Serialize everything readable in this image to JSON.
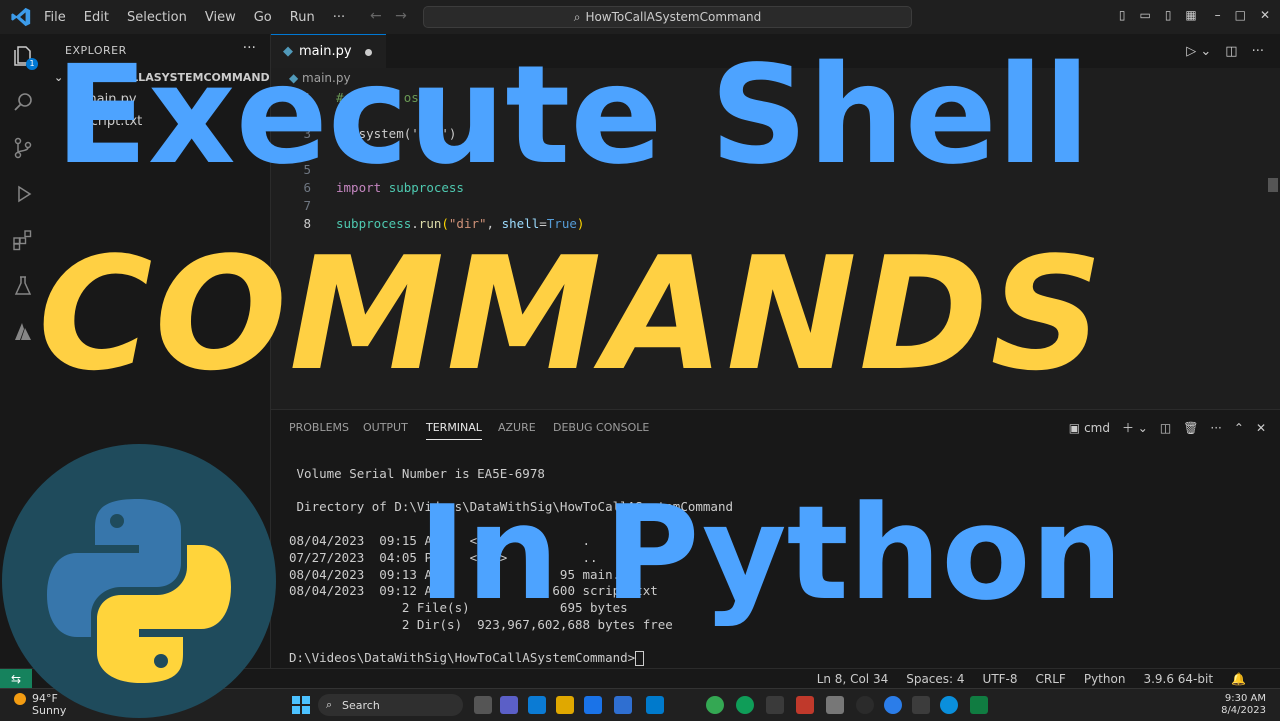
{
  "menu": {
    "items": [
      "File",
      "Edit",
      "Selection",
      "View",
      "Go",
      "Run",
      "···"
    ]
  },
  "title": {
    "search_text": "HowToCallASystemCommand"
  },
  "window_controls": [
    "–",
    "□",
    "✕"
  ],
  "activity_badge": "1",
  "explorer": {
    "title": "EXPLORER",
    "more": "···",
    "folder": "HOWTOCALLASYSTEMCOMMAND",
    "files": [
      "main.py",
      "script.txt"
    ]
  },
  "editor": {
    "tab_label": "main.py",
    "breadcrumb": "main.py",
    "lines": [
      {
        "num": "1",
        "text": "# import os"
      },
      {
        "num": "2",
        "text": ""
      },
      {
        "num": "3",
        "text": "os.system('dir')"
      },
      {
        "num": "4",
        "text": ""
      },
      {
        "num": "5",
        "text": ""
      },
      {
        "num": "6",
        "text": ""
      },
      {
        "num": "7",
        "text": ""
      },
      {
        "num": "8",
        "text": ""
      }
    ],
    "import_kw": "import",
    "import_mod": "subprocess",
    "run_mod": "subprocess",
    "run_fn": "run",
    "run_str": "\"dir\"",
    "run_param": "shell",
    "run_bool": "True"
  },
  "panel": {
    "tabs": [
      "PROBLEMS",
      "OUTPUT",
      "TERMINAL",
      "AZURE",
      "DEBUG CONSOLE"
    ],
    "active_tab": "TERMINAL",
    "shell_name": "cmd",
    "terminal_lines": [
      " Volume Serial Number is EA5E-6978",
      "",
      " Directory of D:\\Videos\\DataWithSig\\HowToCallASystemCommand",
      "",
      "08/04/2023  09:15 AM    <DIR>          .",
      "07/27/2023  04:05 PM    <DIR>          ..",
      "08/04/2023  09:13 AM                95 main.py",
      "08/04/2023  09:12 AM               600 script.txt",
      "               2 File(s)            695 bytes",
      "               2 Dir(s)  923,967,602,688 bytes free",
      "",
      "D:\\Videos\\DataWithSig\\HowToCallASystemCommand>"
    ]
  },
  "status": {
    "remote": "⇆",
    "items": [
      "Ln 8, Col 34",
      "Spaces: 4",
      "UTF-8",
      "CRLF",
      "Python",
      "3.9.6 64-bit"
    ]
  },
  "taskbar": {
    "temp": "94°F",
    "condition": "Sunny",
    "search": "Search",
    "time": "9:30 AM",
    "date": "8/4/2023"
  },
  "overlay": {
    "line1": "Execute Shell",
    "line2": "COMMANDS",
    "line3": "In Python"
  },
  "colors": {
    "overlay_blue": "#4da3ff",
    "overlay_yellow": "#ffd043",
    "accent": "#0078d4",
    "python_blue": "#3776ab",
    "python_yellow": "#ffd43b"
  }
}
